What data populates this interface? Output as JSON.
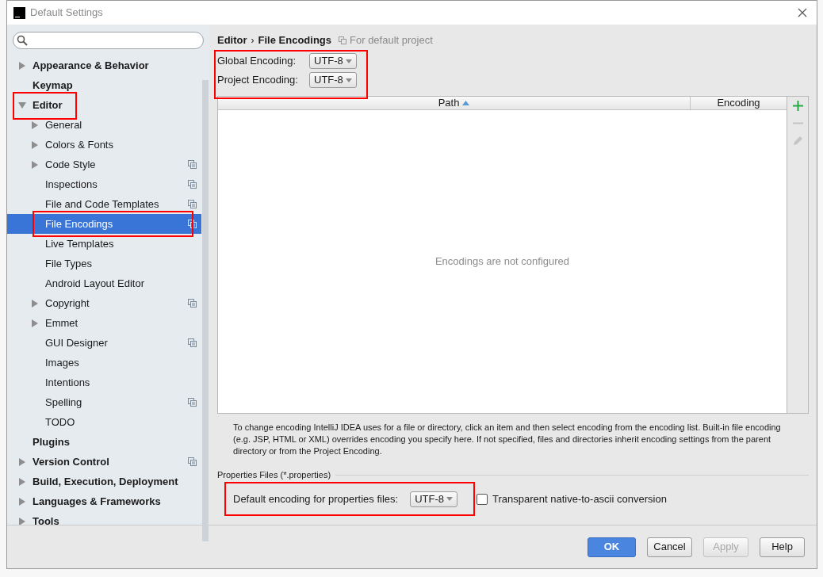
{
  "window": {
    "title": "Default Settings"
  },
  "sidebar": {
    "items": [
      {
        "label": "Appearance & Behavior",
        "kind": "group",
        "expanded": false,
        "selected": false,
        "per_project": false
      },
      {
        "label": "Keymap",
        "kind": "leaf",
        "selected": false,
        "per_project": false
      },
      {
        "label": "Editor",
        "kind": "group",
        "expanded": true,
        "selected": false,
        "per_project": false,
        "children": [
          {
            "label": "General",
            "kind": "group",
            "expanded": false,
            "selected": false,
            "per_project": false
          },
          {
            "label": "Colors & Fonts",
            "kind": "group",
            "expanded": false,
            "selected": false,
            "per_project": false
          },
          {
            "label": "Code Style",
            "kind": "group",
            "expanded": false,
            "selected": false,
            "per_project": true
          },
          {
            "label": "Inspections",
            "kind": "leaf",
            "selected": false,
            "per_project": true
          },
          {
            "label": "File and Code Templates",
            "kind": "leaf",
            "selected": false,
            "per_project": true
          },
          {
            "label": "File Encodings",
            "kind": "leaf",
            "selected": true,
            "per_project": true
          },
          {
            "label": "Live Templates",
            "kind": "leaf",
            "selected": false,
            "per_project": false
          },
          {
            "label": "File Types",
            "kind": "leaf",
            "selected": false,
            "per_project": false
          },
          {
            "label": "Android Layout Editor",
            "kind": "leaf",
            "selected": false,
            "per_project": false
          },
          {
            "label": "Copyright",
            "kind": "group",
            "expanded": false,
            "selected": false,
            "per_project": true
          },
          {
            "label": "Emmet",
            "kind": "group",
            "expanded": false,
            "selected": false,
            "per_project": false
          },
          {
            "label": "GUI Designer",
            "kind": "leaf",
            "selected": false,
            "per_project": true
          },
          {
            "label": "Images",
            "kind": "leaf",
            "selected": false,
            "per_project": false
          },
          {
            "label": "Intentions",
            "kind": "leaf",
            "selected": false,
            "per_project": false
          },
          {
            "label": "Spelling",
            "kind": "leaf",
            "selected": false,
            "per_project": true
          },
          {
            "label": "TODO",
            "kind": "leaf",
            "selected": false,
            "per_project": false
          }
        ]
      },
      {
        "label": "Plugins",
        "kind": "leaf",
        "selected": false,
        "per_project": false
      },
      {
        "label": "Version Control",
        "kind": "group",
        "expanded": false,
        "selected": false,
        "per_project": true
      },
      {
        "label": "Build, Execution, Deployment",
        "kind": "group",
        "expanded": false,
        "selected": false,
        "per_project": false
      },
      {
        "label": "Languages & Frameworks",
        "kind": "group",
        "expanded": false,
        "selected": false,
        "per_project": false
      },
      {
        "label": "Tools",
        "kind": "group",
        "expanded": false,
        "selected": false,
        "per_project": false
      }
    ]
  },
  "header": {
    "breadcrumb": [
      "Editor",
      "File Encodings"
    ],
    "separator": "›",
    "scope_note": "For default project"
  },
  "encodings": [
    {
      "label": "Global Encoding:",
      "value": "UTF-8"
    },
    {
      "label": "Project Encoding:",
      "value": "UTF-8"
    }
  ],
  "table": {
    "columns": [
      {
        "label": "Path",
        "sorted": true
      },
      {
        "label": "Encoding",
        "sorted": false
      }
    ],
    "empty_text": "Encodings are not configured"
  },
  "toolbar": [
    {
      "kind": "add",
      "disabled": false
    },
    {
      "kind": "remove",
      "disabled": true
    },
    {
      "kind": "edit",
      "disabled": true
    }
  ],
  "description": "To change encoding IntelliJ IDEA uses for a file or directory, click an item and then select encoding from the encoding list. Built-in file encoding (e.g. JSP, HTML or XML) overrides encoding you specify here. If not specified, files and directories inherit encoding settings from the parent directory or from the Project Encoding.",
  "properties": {
    "section_title": "Properties Files (*.properties)",
    "label": "Default encoding for properties files:",
    "value": "UTF-8",
    "checkbox": {
      "label": "Transparent native-to-ascii conversion",
      "checked": false
    }
  },
  "buttons": [
    {
      "label": "OK",
      "kind": "default",
      "disabled": false
    },
    {
      "label": "Cancel",
      "kind": "normal",
      "disabled": false
    },
    {
      "label": "Apply",
      "kind": "normal",
      "disabled": true
    },
    {
      "label": "Help",
      "kind": "normal",
      "disabled": false
    }
  ]
}
